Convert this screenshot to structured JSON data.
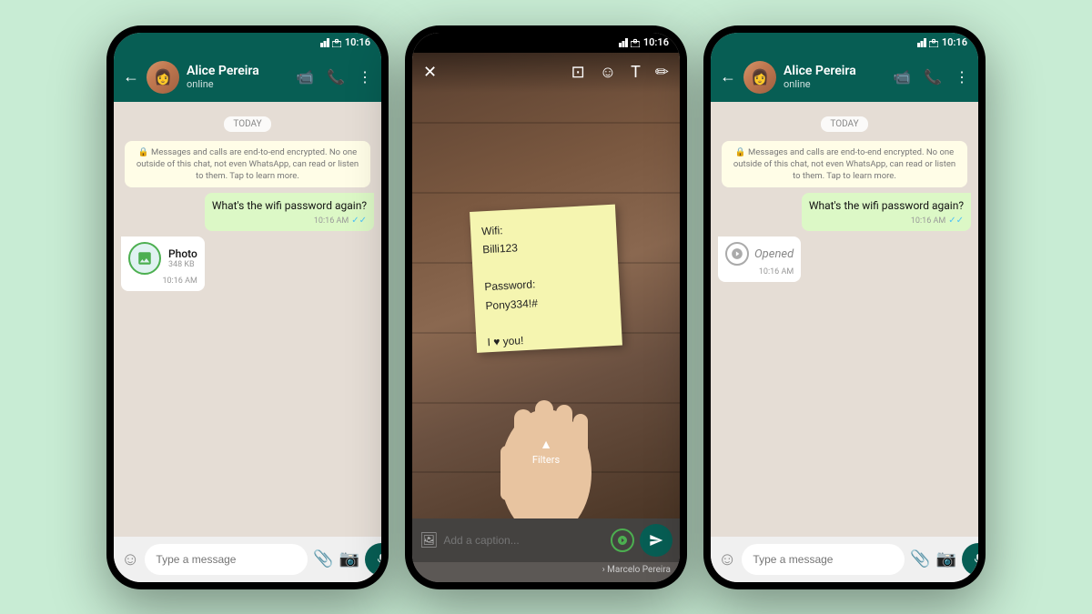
{
  "bg_color": "#c8ecd4",
  "phone1": {
    "status_time": "10:16",
    "contact_name": "Alice Pereira",
    "contact_status": "online",
    "today_label": "TODAY",
    "encryption_text": "Messages and calls are end-to-end encrypted. No one outside of this chat, not even WhatsApp, can read or listen to them. Tap to learn more.",
    "outgoing_msg": "What's the wifi password again?",
    "outgoing_time": "10:16 AM",
    "photo_label": "Photo",
    "photo_size": "348 KB",
    "photo_time": "10:16 AM",
    "input_placeholder": "Type a message",
    "back_label": "←",
    "video_icon": "📹",
    "phone_icon": "📞",
    "more_icon": "⋮"
  },
  "phone2": {
    "viewer_icons": {
      "close": "✕",
      "crop": "⊡",
      "emoji": "☺",
      "text": "T",
      "draw": "✏"
    },
    "sticky_content": "Wifi:\nBilli123\n\nPassword:\nPony334!#\n\nI ♥ you!",
    "filters_label": "Filters",
    "caption_placeholder": "Add a caption...",
    "send_label": "send",
    "marcelo_footer": "› Marcelo Pereira"
  },
  "phone3": {
    "status_time": "10:16",
    "contact_name": "Alice Pereira",
    "contact_status": "online",
    "today_label": "TODAY",
    "encryption_text": "Messages and calls are end-to-end encrypted. No one outside of this chat, not even WhatsApp, can read or listen to them. Tap to learn more.",
    "outgoing_msg": "What's the wifi password again?",
    "outgoing_time": "10:16 AM",
    "opened_label": "Opened",
    "opened_time": "10:16 AM",
    "input_placeholder": "Type a message",
    "back_label": "←"
  }
}
